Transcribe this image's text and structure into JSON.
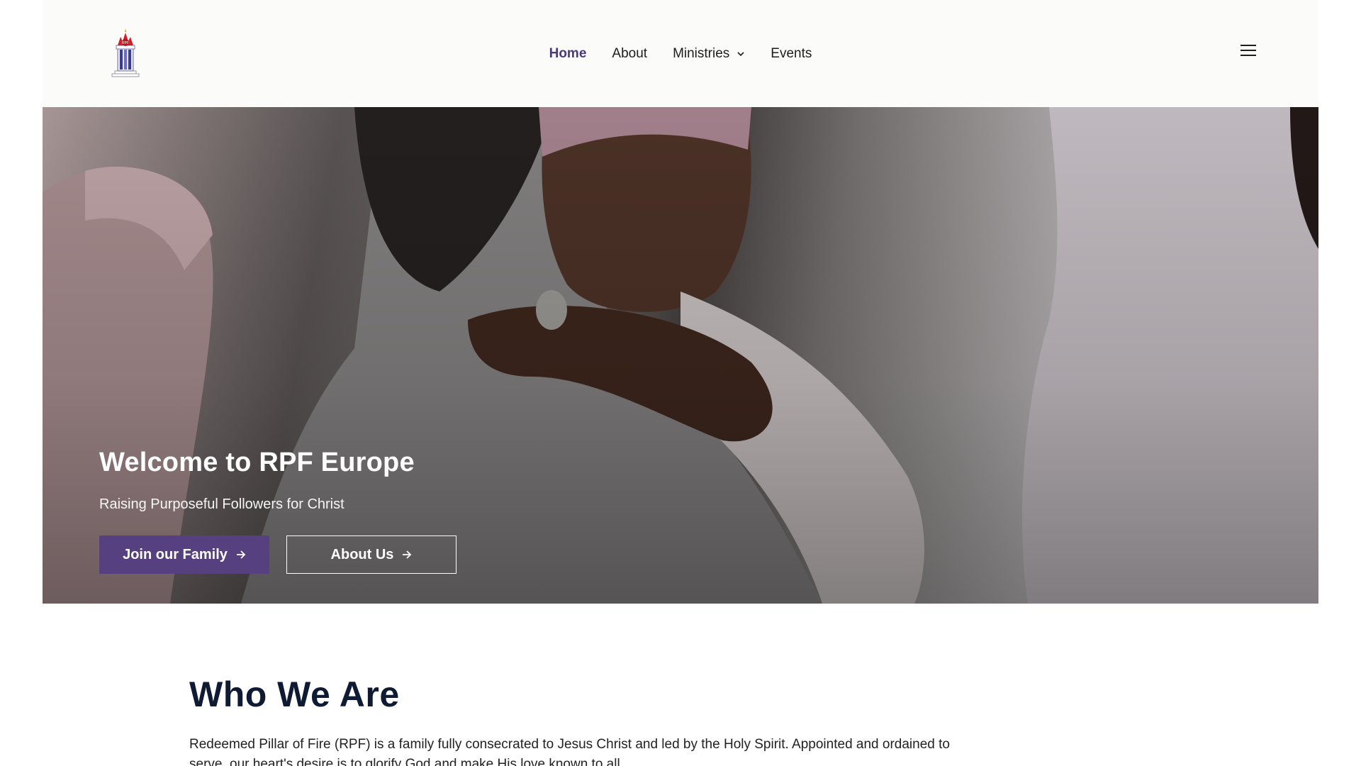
{
  "brand": {
    "logo_name": "RPF pillar logo",
    "logo_badge": "RPF",
    "accent_color": "#56407f"
  },
  "nav": {
    "items": [
      {
        "label": "Home",
        "active": true
      },
      {
        "label": "About"
      },
      {
        "label": "Ministries",
        "has_dropdown": true
      },
      {
        "label": "Events"
      }
    ]
  },
  "hero": {
    "title": "Welcome to RPF Europe",
    "subtitle": "Raising Purposeful Followers for Christ",
    "primary_button": "Join our Family",
    "secondary_button": "About Us"
  },
  "who": {
    "title": "Who We Are",
    "text_line1": "Redeemed Pillar of Fire (RPF) is a family fully consecrated to Jesus Christ and led by the Holy Spirit. Appointed and ordained to",
    "text_line2": "serve, our heart's desire is to glorify God and make His love known to all."
  }
}
